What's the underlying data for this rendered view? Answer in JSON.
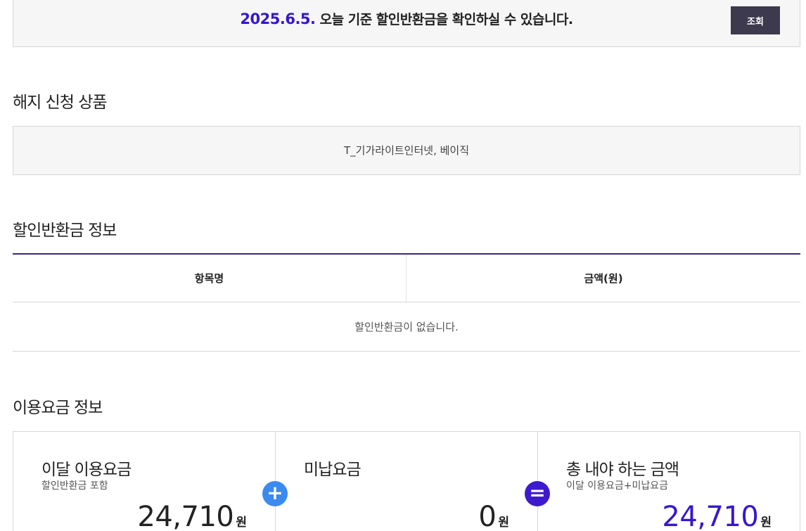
{
  "query": {
    "date": "2025.6.5.",
    "message": " 오늘 기준 할인반환금을 확인하실 수 있습니다.",
    "button_label": "조회"
  },
  "product_section": {
    "title": "해지 신청 상품",
    "value": "T_기가라이트인터넷, 베이직"
  },
  "refund_section": {
    "title": "할인반환금 정보",
    "columns": [
      "항목명",
      "금액(원)"
    ],
    "empty_message": "할인반환금이 없습니다."
  },
  "usage_section": {
    "title": "이용요금 정보",
    "items": [
      {
        "title": "이달 이용요금",
        "subtitle": "할인반환금 포함",
        "amount": "24,710",
        "unit": "원"
      },
      {
        "title": "미납요금",
        "subtitle": "",
        "amount": "0",
        "unit": "원"
      },
      {
        "title": "총 내야 하는 금액",
        "subtitle": "이달 이용요금+미납요금",
        "amount": "24,710",
        "unit": "원"
      }
    ],
    "operators": {
      "plus": "+",
      "equals": "="
    }
  },
  "colors": {
    "accent": "#3617ce",
    "button_bg": "#3d3a4e",
    "plus_icon": "#3b8af0",
    "equals_icon": "#3d1ad0",
    "table_top_border": "#3b2a77"
  }
}
